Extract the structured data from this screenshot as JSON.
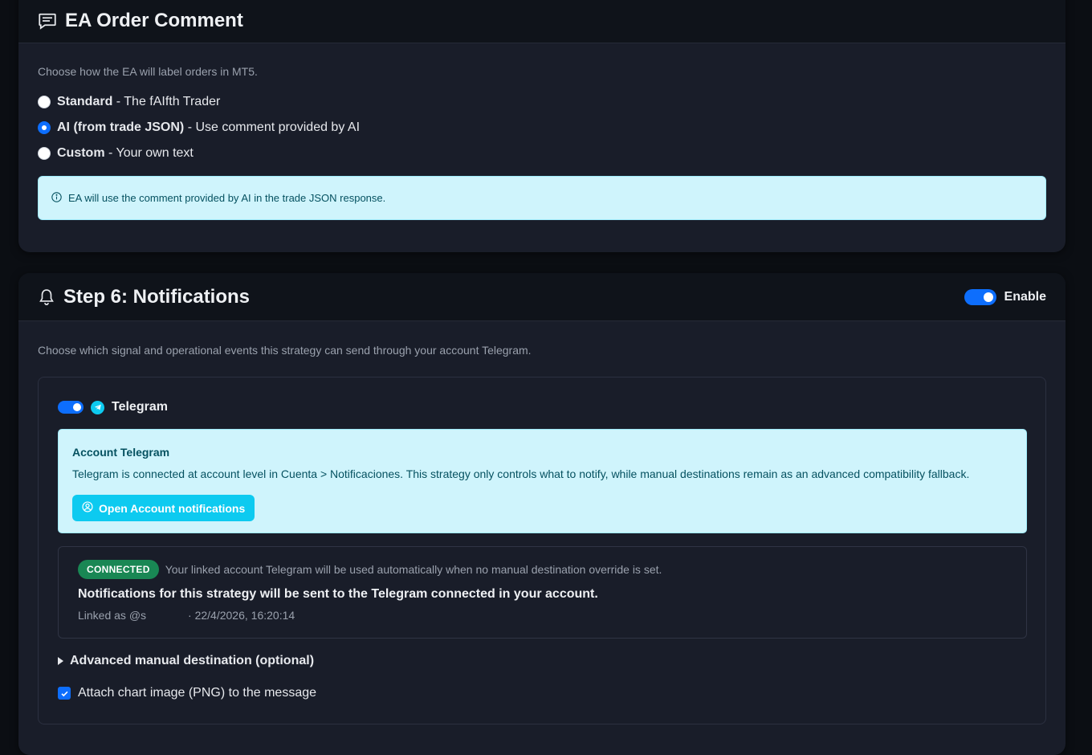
{
  "ea_comment": {
    "title": "EA Order Comment",
    "description": "Choose how the EA will label orders in MT5.",
    "options": [
      {
        "label": "Standard",
        "desc": " - The fAIfth Trader",
        "checked": false
      },
      {
        "label": "AI (from trade JSON)",
        "desc": " - Use comment provided by AI",
        "checked": true
      },
      {
        "label": "Custom",
        "desc": " - Your own text",
        "checked": false
      }
    ],
    "info": "EA will use the comment provided by AI in the trade JSON response."
  },
  "notifications": {
    "title": "Step 6: Notifications",
    "enable_label": "Enable",
    "enabled": true,
    "description": "Choose which signal and operational events this strategy can send through your account Telegram.",
    "telegram": {
      "label": "Telegram",
      "enabled": true,
      "account_box": {
        "title": "Account Telegram",
        "text": "Telegram is connected at account level in Cuenta > Notificaciones. This strategy only controls what to notify, while manual destinations remain as an advanced compatibility fallback.",
        "button": "Open Account notifications"
      },
      "status": {
        "badge": "CONNECTED",
        "note": "Your linked account Telegram will be used automatically when no manual destination override is set.",
        "main": "Notifications for this strategy will be sent to the Telegram connected in your account.",
        "linked_prefix": "Linked as @s",
        "linked_date": "· 22/4/2026, 16:20:14"
      },
      "advanced_label": "Advanced manual destination (optional)",
      "attach_label": "Attach chart image (PNG) to the message",
      "attach_checked": true
    }
  },
  "colors": {
    "primary": "#0d6efd",
    "info_bg": "#cff4fc",
    "info_text": "#055160",
    "success": "#198754",
    "card_bg": "#191d29",
    "header_bg": "#0f131a"
  }
}
